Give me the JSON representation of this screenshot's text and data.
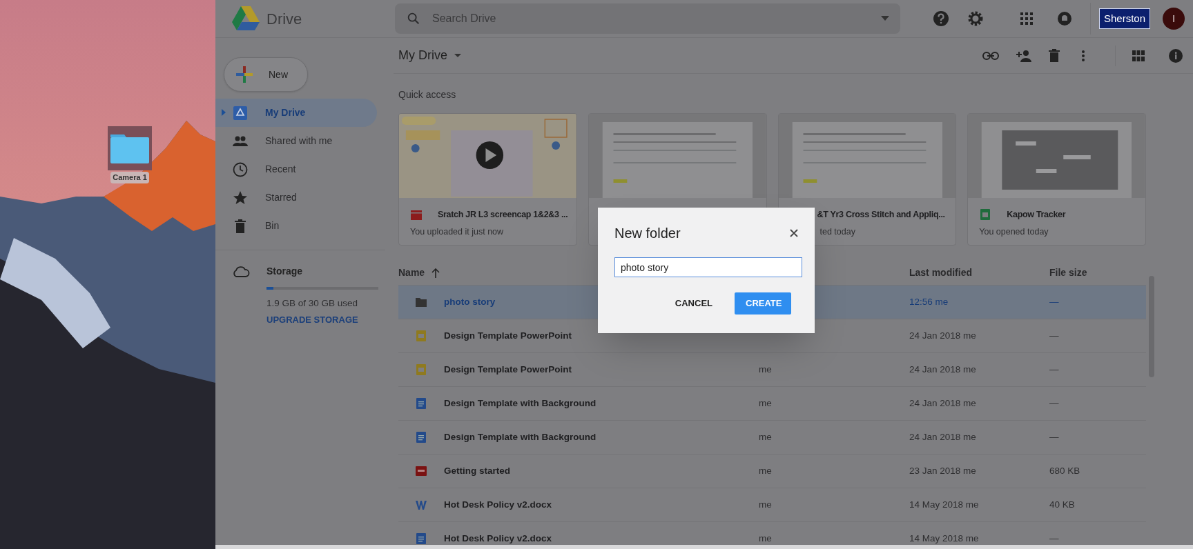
{
  "desktop": {
    "icons": [
      {
        "label": "Camera 1",
        "selected": true
      }
    ]
  },
  "app": {
    "name": "Drive"
  },
  "search": {
    "placeholder": "Search Drive"
  },
  "account": {
    "org_label": "Sherston",
    "avatar_initial": "I"
  },
  "new_button": {
    "label": "New"
  },
  "sidebar": {
    "items": [
      {
        "label": "My Drive",
        "kind": "drive",
        "selected": true,
        "expandable": true
      },
      {
        "label": "Shared with me",
        "kind": "people",
        "selected": false,
        "expandable": false
      },
      {
        "label": "Recent",
        "kind": "clock",
        "selected": false,
        "expandable": false
      },
      {
        "label": "Starred",
        "kind": "star",
        "selected": false,
        "expandable": false
      },
      {
        "label": "Bin",
        "kind": "trash",
        "selected": false,
        "expandable": false
      }
    ]
  },
  "storage": {
    "label": "Storage",
    "level": 0.063,
    "usage": "1.9 GB of 30 GB used",
    "upgrade": "UPGRADE STORAGE"
  },
  "location": {
    "title": "My Drive"
  },
  "quick_access": {
    "heading": "Quick access",
    "cards": [
      {
        "kind": "video",
        "title": "Sratch JR L3 screencap 1&2&3 ...",
        "subtitle": "You uploaded it just now"
      },
      {
        "kind": "document"
      },
      {
        "kind": "document",
        "title": "&T Yr3 Cross Stitch and Appliq...",
        "subtitle": "ted today"
      },
      {
        "kind": "spreadsheet",
        "title": "Kapow Tracker",
        "subtitle": "You opened today"
      }
    ]
  },
  "file_list": {
    "columns": [
      {
        "label": "Name",
        "sorted": true
      },
      {
        "label": "Last modified",
        "sorted": false
      },
      {
        "label": "File size",
        "sorted": false
      }
    ],
    "rows": [
      {
        "name": "photo story",
        "kind": "folder",
        "modified": "12:56 me",
        "size": "—",
        "selected": true
      },
      {
        "name": "Design Template PowerPoint",
        "kind": "slides",
        "modified": "24 Jan 2018 me",
        "size": "—",
        "selected": false
      },
      {
        "name": "Design Template PowerPoint",
        "kind": "slides",
        "owner": "me",
        "modified": "24 Jan 2018 me",
        "size": "—",
        "selected": false
      },
      {
        "name": "Design Template with Background",
        "kind": "doc",
        "owner": "me",
        "modified": "24 Jan 2018 me",
        "size": "—",
        "selected": false
      },
      {
        "name": "Design Template with Background",
        "kind": "doc",
        "owner": "me",
        "modified": "24 Jan 2018 me",
        "size": "—",
        "selected": false
      },
      {
        "name": "Getting started",
        "kind": "pdf",
        "owner": "me",
        "modified": "23 Jan 2018 me",
        "size": "680 KB",
        "selected": false
      },
      {
        "name": "Hot Desk Policy v2.docx",
        "kind": "word",
        "owner": "me",
        "modified": "14 May 2018 me",
        "size": "40 KB",
        "selected": false
      },
      {
        "name": "Hot Desk Policy v2.docx",
        "kind": "doc",
        "owner": "me",
        "modified": "14 May 2018 me",
        "size": "—",
        "selected": false
      }
    ]
  },
  "dialog": {
    "title": "New folder",
    "value": "photo story",
    "buttons": [
      {
        "label": "CANCEL",
        "kind": "text"
      },
      {
        "label": "CREATE",
        "kind": "primary"
      }
    ]
  }
}
